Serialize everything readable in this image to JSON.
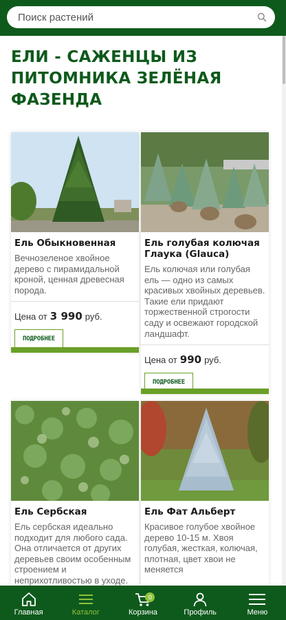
{
  "search": {
    "placeholder": "Поиск растений",
    "value": ""
  },
  "page": {
    "title": "ЕЛИ - САЖЕНЦЫ ИЗ ПИТОМНИКА ЗЕЛЁНАЯ ФАЗЕНДА"
  },
  "products": [
    {
      "name": "Ель Обыкновенная",
      "description": "Вечнозеленое хвойное дерево с пирамидальной кроной, ценная древесная порода.",
      "price_prefix": "Цена от",
      "price": "3 990",
      "currency": "руб.",
      "button": "ПОДРОБНЕЕ"
    },
    {
      "name": "Ель голубая колючая Глаука (Glauca)",
      "description": "Ель колючая или голубая ель — одно из самых красивых хвойных деревьев. Такие ели придают торжественной строгости саду и освежают городской ландшафт.",
      "price_prefix": "Цена от",
      "price": "990",
      "currency": "руб.",
      "button": "ПОДРОБНЕЕ"
    },
    {
      "name": "Ель Сербская",
      "description": "Ель сербская идеально подходит для любого сада. Она отличается от других деревьев своим особенным строением и неприхотливостью в уходе."
    },
    {
      "name": "Ель Фат Альберт",
      "description": "Красивое голубое хвойное дерево 10-15 м. Хвоя голубая, жесткая, колючая, плотная, цвет хвои не меняется"
    }
  ],
  "nav": {
    "home": "Главная",
    "catalog": "Каталог",
    "cart": "Корзина",
    "cart_count": "0",
    "profile": "Профиль",
    "menu": "Меню"
  },
  "colors": {
    "brand": "#0e5a1c",
    "accent": "#8fc23d",
    "bar": "#6aa028"
  }
}
